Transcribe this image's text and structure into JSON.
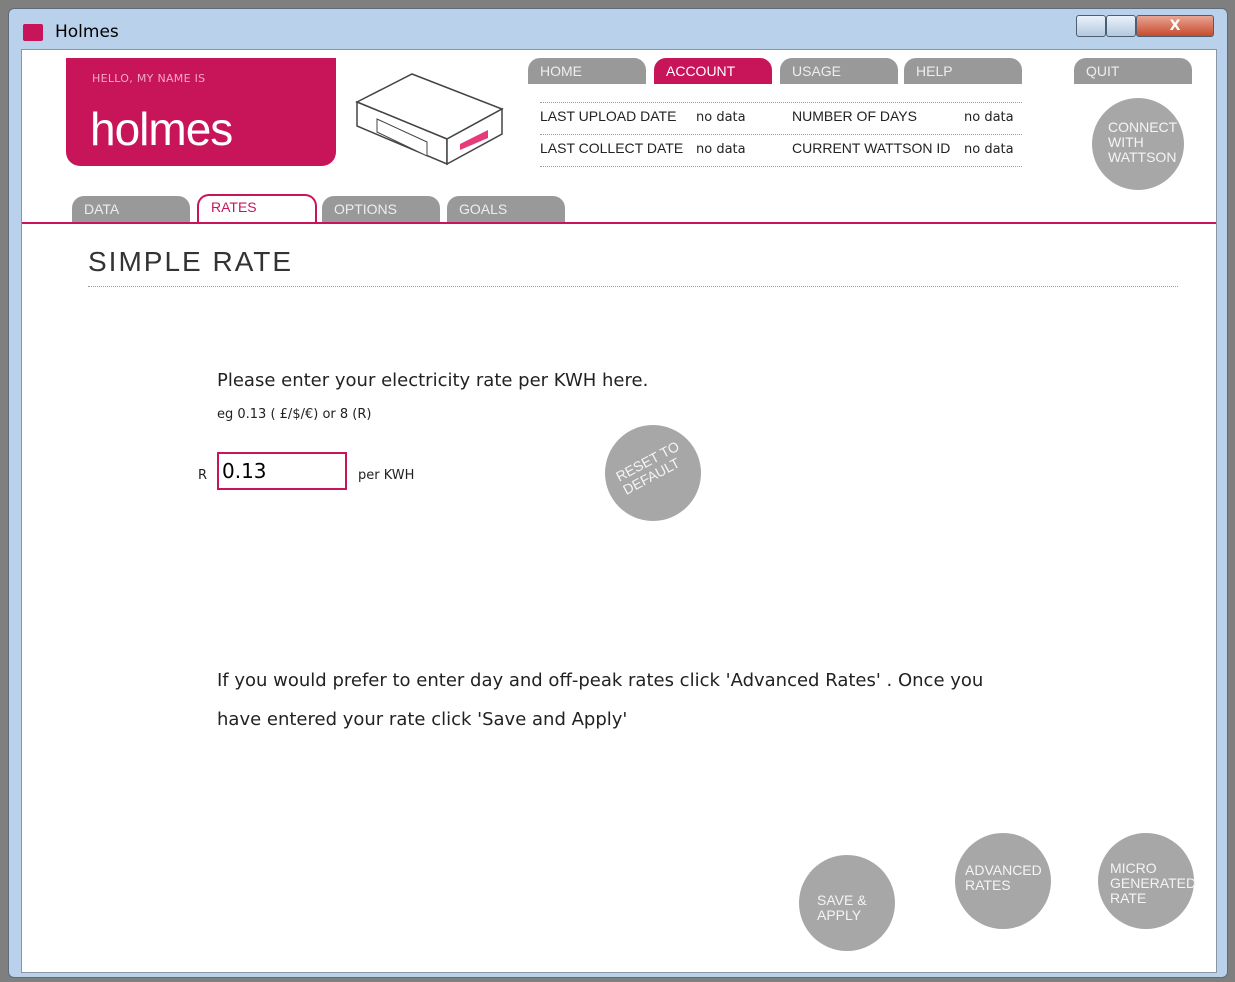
{
  "window": {
    "title": "Holmes",
    "close_glyph": "X"
  },
  "brand": {
    "hello": "HELLO, MY NAME IS",
    "name": "holmes"
  },
  "nav": [
    {
      "label": "HOME"
    },
    {
      "label": "ACCOUNT"
    },
    {
      "label": "USAGE"
    },
    {
      "label": "HELP"
    },
    {
      "label": "QUIT"
    }
  ],
  "info": {
    "last_upload_label": "LAST UPLOAD DATE",
    "last_upload_value": "no data",
    "last_collect_label": "LAST COLLECT DATE",
    "last_collect_value": "no data",
    "days_label": "NUMBER OF DAYS",
    "days_value": "no data",
    "wattson_label": "CURRENT WATTSON ID",
    "wattson_value": "no data"
  },
  "connect_button": "CONNECT WITH WATTSON",
  "tabs": [
    {
      "label": "DATA"
    },
    {
      "label": "RATES"
    },
    {
      "label": "OPTIONS"
    },
    {
      "label": "GOALS"
    }
  ],
  "section_title": "SIMPLE RATE",
  "rate": {
    "prompt": "Please enter your electricity rate per KWH here.",
    "example": "eg 0.13 ( £/$/€) or 8 (R)",
    "currency": "R",
    "value": "0.13",
    "unit": "per KWH"
  },
  "reset_button": "RESET TO DEFAULT",
  "help_text_line1": "If you would prefer to enter day and off-peak rates click 'Advanced Rates' . Once you",
  "help_text_line2": "have entered your rate click 'Save and Apply'",
  "buttons": {
    "save": "SAVE & APPLY",
    "advanced": "ADVANCED RATES",
    "micro": "MICRO GENERATED RATE"
  },
  "colors": {
    "accent": "#c8155a",
    "button_grey": "#a7a7a7"
  }
}
